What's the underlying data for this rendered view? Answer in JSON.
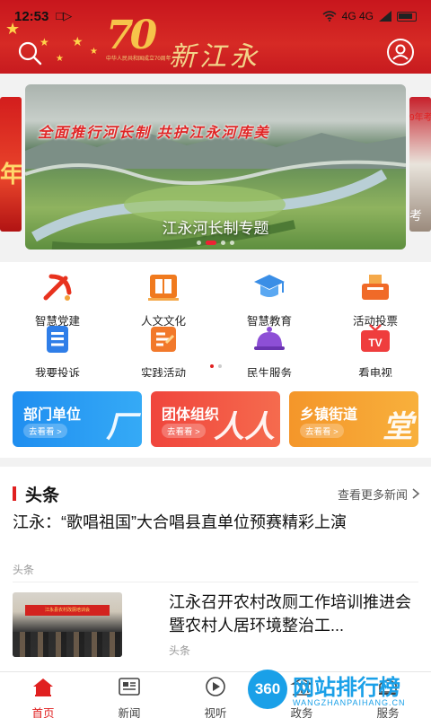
{
  "status_bar": {
    "time": "12:53",
    "left_icons": "□▷",
    "right_text": "4G 4G"
  },
  "header": {
    "anniversary_number": "70",
    "anniversary_caption": "中华人民共和国成立70周年",
    "brand": "新江永"
  },
  "banner": {
    "slogan": "全面推行河长制  共护江永河库美",
    "caption": "江永河长制专题",
    "left_peek_text": "年",
    "right_peek_top": "9年考",
    "right_peek_bottom": "考"
  },
  "grid": {
    "items": [
      {
        "label": "智慧党建",
        "icon": "party-emblem-icon",
        "color": "#e8321e"
      },
      {
        "label": "人文文化",
        "icon": "book-icon",
        "color": "#f07a1e"
      },
      {
        "label": "智慧教育",
        "icon": "graduation-cap-icon",
        "color": "#3a8ee6"
      },
      {
        "label": "活动投票",
        "icon": "ballot-box-icon",
        "color": "#f06a28"
      },
      {
        "label": "我要投诉",
        "icon": "complaint-icon",
        "color": "#2f7ee8"
      },
      {
        "label": "实践活动",
        "icon": "practice-icon",
        "color": "#f2792b"
      },
      {
        "label": "民生服务",
        "icon": "service-bell-icon",
        "color": "#8d4fd6"
      },
      {
        "label": "看电视",
        "icon": "tv-icon",
        "color": "#ef3d3d"
      }
    ]
  },
  "cards": [
    {
      "title": "部门单位",
      "sub": "去看看 >",
      "glyph": "厂",
      "color_from": "#1f8ef0",
      "color_to": "#35aaf6"
    },
    {
      "title": "团体组织",
      "sub": "去看看 >",
      "glyph": "人人",
      "color_from": "#f0453c",
      "color_to": "#f56b4e"
    },
    {
      "title": "乡镇街道",
      "sub": "去看看 >",
      "glyph": "堂",
      "color_from": "#f4962a",
      "color_to": "#f8b03c"
    }
  ],
  "news": {
    "section_title": "头条",
    "more_label": "查看更多新闻",
    "item1_title": "江永：“歌唱祖国”大合唱县直单位预赛精彩上演",
    "item1_tag": "头条",
    "item2_title": "江永召开农村改厕工作培训推进会暨农村人居环境整治工...",
    "item2_tag": "头条",
    "item2_image_banner": "江永县农村改厕培训会"
  },
  "tabs": [
    {
      "label": "首页",
      "icon": "home-icon",
      "active": true
    },
    {
      "label": "新闻",
      "icon": "newspaper-icon",
      "active": false
    },
    {
      "label": "视听",
      "icon": "play-icon",
      "active": false
    },
    {
      "label": "政务",
      "icon": "government-icon",
      "active": false
    },
    {
      "label": "服务",
      "icon": "service-icon",
      "active": false
    }
  ],
  "watermark": {
    "badge": "360",
    "title": "网站排行榜",
    "url": "WANGZHANPAIHANG.CN"
  },
  "colors": {
    "header_red": "#c8161d",
    "accent_red": "#e02020",
    "gold": "#f2d489",
    "watermark_blue": "#1aa0e8"
  }
}
